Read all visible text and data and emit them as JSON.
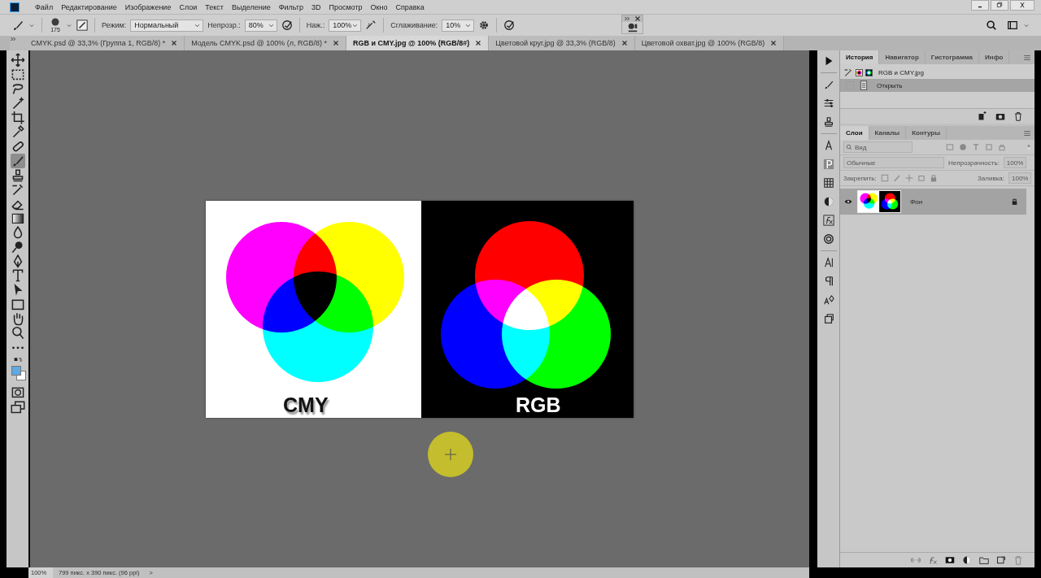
{
  "menu": [
    "Файл",
    "Редактирование",
    "Изображение",
    "Слои",
    "Текст",
    "Выделение",
    "Фильтр",
    "3D",
    "Просмотр",
    "Окно",
    "Справка"
  ],
  "options": {
    "brush_size": "175",
    "mode_label": "Режим:",
    "mode": "Нормальный",
    "opacity_label": "Непрозр.:",
    "opacity": "80%",
    "pressure_label": "Наж.:",
    "pressure": "100%",
    "smoothing_label": "Сглаживание:",
    "smoothing": "10%"
  },
  "tabs": [
    {
      "label": "CMYK.psd @ 33,3% (Группа 1, RGB/8) *",
      "selected": false
    },
    {
      "label": "Модель CMYK.psd @ 100% (л, RGB/8) *",
      "selected": false
    },
    {
      "label": "RGB и CMY.jpg @ 100% (RGB/8#)",
      "selected": true
    },
    {
      "label": "Цветовой круг.jpg @ 33,3% (RGB/8)",
      "selected": false
    },
    {
      "label": "Цветовой охват.jpg @ 100% (RGB/8)",
      "selected": false
    }
  ],
  "tools": [
    {
      "kind": "move",
      "selected": false
    },
    {
      "kind": "marquee",
      "selected": false
    },
    {
      "kind": "lasso",
      "selected": false
    },
    {
      "kind": "wand",
      "selected": false
    },
    {
      "kind": "crop",
      "selected": false
    },
    {
      "kind": "eyedropper",
      "selected": false
    },
    {
      "kind": "healing",
      "selected": false
    },
    {
      "kind": "brush",
      "selected": true
    },
    {
      "kind": "stamp",
      "selected": false
    },
    {
      "kind": "history",
      "selected": false
    },
    {
      "kind": "eraser",
      "selected": false
    },
    {
      "kind": "gradient",
      "selected": false
    },
    {
      "kind": "blur",
      "selected": false
    },
    {
      "kind": "dodge",
      "selected": false
    },
    {
      "kind": "pen",
      "selected": false
    },
    {
      "kind": "type",
      "selected": false
    },
    {
      "kind": "path",
      "selected": false
    },
    {
      "kind": "rect",
      "selected": false
    },
    {
      "kind": "hand",
      "selected": false
    },
    {
      "kind": "zoom",
      "selected": false
    },
    {
      "kind": "more",
      "selected": false
    }
  ],
  "image": {
    "left_caption": "CMY",
    "right_caption": "RGB"
  },
  "status": {
    "zoom": "100%",
    "info": "799 пикс. x 390 пикс. (96 ppi)",
    "arrow": ">"
  },
  "history": {
    "tabs": [
      {
        "label": "История",
        "selected": true
      },
      {
        "label": "Навигатор",
        "selected": false
      },
      {
        "label": "Гистограмма",
        "selected": false
      },
      {
        "label": "Инфо",
        "selected": false
      }
    ],
    "snapshot": "RGB и CMY.jpg",
    "steps": [
      {
        "label": "Открыть",
        "selected": true
      }
    ]
  },
  "layers": {
    "tabs": [
      {
        "label": "Слои",
        "selected": true
      },
      {
        "label": "Каналы",
        "selected": false
      },
      {
        "label": "Контуры",
        "selected": false
      }
    ],
    "filter_placeholder": "Вид",
    "blend": "Обычные",
    "opacity_label": "Непрозрачность:",
    "opacity": "100%",
    "lock_label": "Закрепить:",
    "fill_label": "Заливка:",
    "fill": "100%",
    "items": [
      {
        "name": "Фон",
        "visible": true,
        "locked": true,
        "selected": true
      }
    ]
  }
}
